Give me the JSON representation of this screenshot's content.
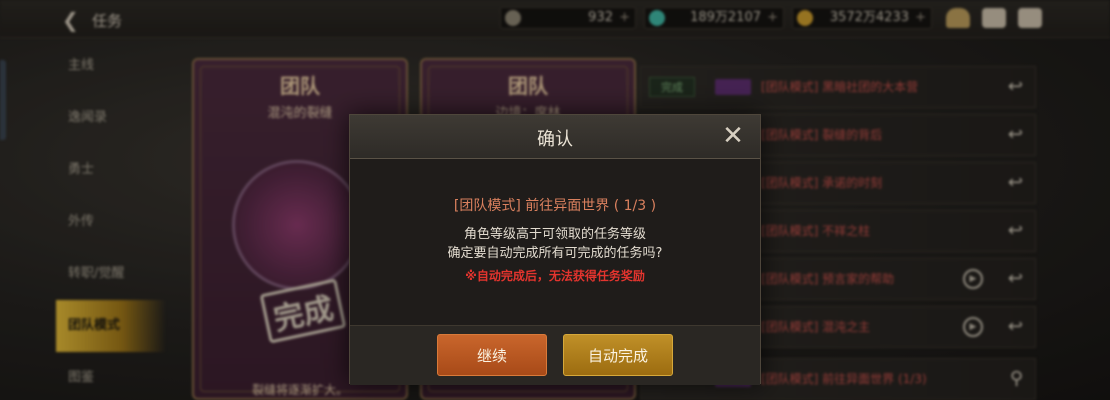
{
  "header": {
    "back_icon": "back-arrow-icon",
    "title": "任务",
    "currencies": [
      {
        "icon": "coin-c-icon",
        "value": "932",
        "plus": "+",
        "color": "#8a8270"
      },
      {
        "icon": "green-gem-icon",
        "value": "189万2107",
        "plus": "+",
        "color": "#3fb3a0"
      },
      {
        "icon": "gold-coin-icon",
        "value": "3572万4233",
        "plus": "+",
        "color": "#c99a2c"
      }
    ],
    "icons": [
      "cake-icon",
      "mail-icon",
      "chat-icon"
    ]
  },
  "sidebar": {
    "items": [
      {
        "label": "主线"
      },
      {
        "label": "逸闻录"
      },
      {
        "label": "勇士"
      },
      {
        "label": "外传"
      },
      {
        "label": "转职/觉醒"
      },
      {
        "label": "团队模式",
        "active": true
      },
      {
        "label": "图鉴"
      }
    ]
  },
  "cards": [
    {
      "title": "团队",
      "subtitle": "混沌的裂缝",
      "stamp": "完成",
      "desc": "裂缝将逐渐扩大。"
    },
    {
      "title": "团队",
      "subtitle": "边境：席林",
      "stamp": "",
      "desc": ""
    }
  ],
  "quests": [
    {
      "badge": "完成",
      "text": "[团队模式] 黑暗社团的大本营",
      "action": "return-icon"
    },
    {
      "badge": "",
      "text": "[团队模式] 裂缝的背后",
      "action": "return-icon"
    },
    {
      "badge": "",
      "text": "[团队模式] 承诺的时刻",
      "action": "return-icon"
    },
    {
      "badge": "",
      "text": "[团队模式] 不祥之柱",
      "action": "return-icon"
    },
    {
      "badge": "",
      "text": "[团队模式] 预言家的帮助",
      "action": "return-icon",
      "play": true
    },
    {
      "badge": "",
      "text": "[团队模式] 混沌之主",
      "action": "return-icon",
      "play": true
    },
    {
      "badge": "",
      "text": "[团队模式] 前往异面世界 (1/3)",
      "action": "search-icon"
    }
  ],
  "dialog": {
    "title": "确认",
    "quest_name": "[团队模式] 前往异面世界 ( 1/3 )",
    "message_line1": "角色等级高于可领取的任务等级",
    "message_line2": "确定要自动完成所有可完成的任务吗?",
    "warning": "※自动完成后，无法获得任务奖励",
    "continue_label": "继续",
    "auto_complete_label": "自动完成",
    "close_icon": "close-icon"
  },
  "colors": {
    "active_tab": "#e0b838",
    "continue_button": "#c9662c",
    "auto_complete_button": "#c09028",
    "warning_text": "#e3342e",
    "quest_text": "#d9805e"
  }
}
